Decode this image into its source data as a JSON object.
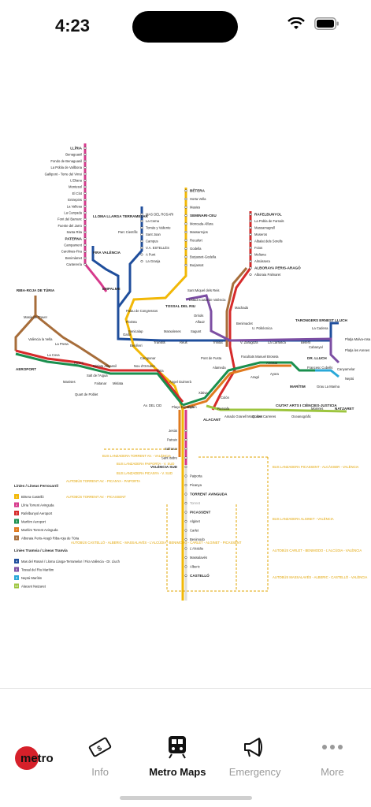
{
  "status": {
    "time": "4:23"
  },
  "map": {
    "lines_l2": [
      "LLÍRIA",
      "Benaguasil",
      "Fondo de Benaguasil",
      "La Pobla de Vallbona",
      "Gallipont - Torre del Virrei",
      "L'Eliana",
      "Montesol",
      "El Clot",
      "Entrepins",
      "La Vallesa",
      "La Canyada",
      "Font del Barranc",
      "Fuente del Jarro",
      "Santa Rita",
      "PATERNA",
      "Campament",
      "Carolines-Fira",
      "Benimàmet",
      "Canterería"
    ],
    "lines_l4": [
      "MAS DEL ROSARI",
      "La Coma",
      "Tomás y Valiente",
      "Sant Joan",
      "Campus",
      "V.A. ESTELLÉS",
      "A Punt",
      "La Granja"
    ],
    "lines_l1_north": [
      "BÉTERA",
      "Horta Vella",
      "Masies",
      "SEMINARI-CEU",
      "Moncada-Alfara",
      "Massarrojos",
      "Rocafort",
      "Godella",
      "Burjassot-Godella",
      "Burjassot"
    ],
    "lines_l3_north": [
      "RAFELBUNYOL",
      "La Pobla de Farnals",
      "Massamagrell",
      "Museros",
      "Albalat dels Sorells",
      "Foios",
      "Meliana",
      "Almàssera",
      "ALBORAYA PERIS-ARAGÓ",
      "Alboraia Palmaret"
    ],
    "west": [
      "RIBA-ROJA DE TÚRIA",
      "Masia de Traver",
      "València la Vella",
      "La Presa",
      "La Cova",
      "Roses",
      "Manises",
      "Salt de l'Aigua",
      "Quart de Poblet",
      "AEROPORT"
    ],
    "central": [
      "LLOMA LLARGA TERRAMELAR",
      "Parc Científic",
      "FIRA VALÈNCIA",
      "EMPALME",
      "Palau de Congressos",
      "Florista",
      "Garbí",
      "Beniferri",
      "Campanar",
      "Túria",
      "Àngel Guimerà",
      "Faitanar",
      "Mislata",
      "Mislata Almassil",
      "Nou d'Octubre",
      "Av. DEL CID",
      "Plaça Espanya",
      "Bailén",
      "Xàtiva",
      "Colón",
      "Alameda"
    ],
    "east": [
      "Benicalap",
      "Trànsits",
      "Marxalenes",
      "Reus",
      "Sagunt",
      "Pont de Fusta",
      "TOSSAL DEL RIU",
      "Sant Miquel dels Reis",
      "Estadi Ciutat de València",
      "Orriols",
      "Alfauir",
      "Machado",
      "Benimaclet",
      "Trinitat",
      "V. Zaragozà",
      "U. Politècnica",
      "La Carrasca",
      "TARONGERS ERNEST LLUCH",
      "La Cadena",
      "Beteró",
      "Cabanyal",
      "DR. LLUCH",
      "Platja Malva-rosa",
      "Platja les Arenes",
      "Facultats Manuel Broseta",
      "Amistat",
      "Ayora",
      "Aragó",
      "MARÍTIM",
      "Francesc Cubells",
      "Grau La Marina",
      "Neptú",
      "Canyamelar",
      "Russafa",
      "Amado Granell Montolivet",
      "Quatre Carreres",
      "CIUTAT ARTS I CIÈNCIES-JUSTICIA",
      "Oceanogràfic",
      "Moreres",
      "NATZARET",
      "ALACANT"
    ],
    "south": [
      "Jesús",
      "Patraix",
      "Safranar",
      "Sant Isidre",
      "VALÈNCIA SUD",
      "Paiporta",
      "Picanya",
      "TORRENT AVINGUDA",
      "Torrent",
      "PICASSENT",
      "Alginet",
      "Carlet",
      "Benimodo",
      "L'Alcúdia",
      "Massalavés",
      "Alberic",
      "CASTELLÓ"
    ],
    "bus_notes": [
      "BUS LANZADERA TORRENT AV. - VALÈNCIA",
      "BUS LANZADERA PAIPORTA - V. SUD",
      "BUS LANZADERA PICANYA - V. SUD",
      "AUTOBÚS TORRENT AV. - PICANYA - PAIPORTA",
      "AUTOBÚS TORRENT AV. - PICASSENT",
      "BUS LANZADERA PICASSENT - ALCÀSSER - VALÈNCIA",
      "BUS LANZADERA ALGINET - VALÈNCIA",
      "AUTOBÚS CASTELLÓ - ALBERIC - MASSALAVÉS - L'ALCÚDIA - BENIMODO - CARLET - ALGINET - PICASSENT",
      "AUTOBÚS CARLET - BENIMODO - L'ALCÚDIA - VALÈNCIA",
      "AUTOBÚS MASSALAVÉS - ALBERIC - CASTELLÓ - VALÈNCIA"
    ],
    "legend_title_metro": "Línies / Líneas Ferrocarril",
    "legend_metro": [
      {
        "n": "1",
        "name": "Bètera Castelló",
        "color": "#f2b807"
      },
      {
        "n": "2",
        "name": "Llíria Torrent Avinguda",
        "color": "#d63a8c"
      },
      {
        "n": "3",
        "name": "Rafelbunyol Aeroport",
        "color": "#d62a2a"
      },
      {
        "n": "5",
        "name": "Marítim Aeroport",
        "color": "#1a8f4e"
      },
      {
        "n": "7",
        "name": "Marítim Torrent Avinguda",
        "color": "#e07a1f"
      },
      {
        "n": "9",
        "name": "Alboraia Peris-Aragó Riba-roja de Túria",
        "color": "#a76d3a"
      }
    ],
    "legend_title_tram": "Línies Tramvia / Líneas Tranvía",
    "legend_tram": [
      {
        "n": "4",
        "name": "Mas del Rosari / Lloma Llarga-Terramelar / Fira València - Dr. Lluch",
        "color": "#1f4e9c"
      },
      {
        "n": "6",
        "name": "Tossal del Riu Marítim",
        "color": "#7c4ea3"
      },
      {
        "n": "8",
        "name": "Neptú Marítim",
        "color": "#2aa8d8"
      },
      {
        "n": "10",
        "name": "Alacant Natzaret",
        "color": "#9dc53f"
      }
    ]
  },
  "tabs": [
    {
      "label": "Info",
      "icon": "ticket-icon"
    },
    {
      "label": "Metro Maps",
      "icon": "train-icon"
    },
    {
      "label": "Emergency",
      "icon": "megaphone-icon"
    },
    {
      "label": "More",
      "icon": "more-dots-icon"
    }
  ],
  "logo_text": "metro",
  "colors": {
    "l1": "#f2b807",
    "l2": "#d63a8c",
    "l3": "#d62a2a",
    "l4": "#1f4e9c",
    "l5": "#1a8f4e",
    "l6": "#7c4ea3",
    "l7": "#e07a1f",
    "l8": "#2aa8d8",
    "l9": "#a76d3a",
    "l10": "#9dc53f"
  }
}
